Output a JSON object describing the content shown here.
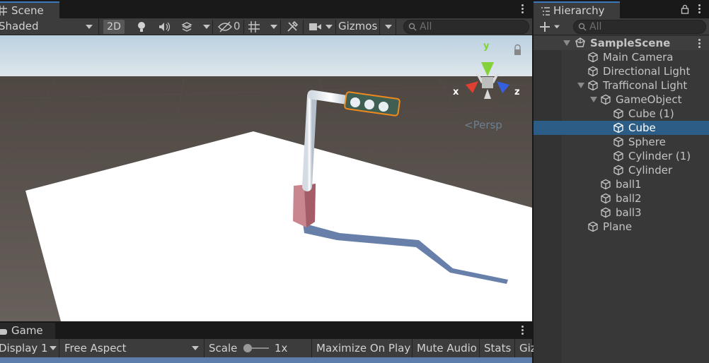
{
  "scene": {
    "tab_label": "Scene",
    "shading_mode": "Shaded",
    "btn_2d": "2D",
    "hidden_count": "0",
    "gizmos_label": "Gizmos",
    "search_placeholder": "All",
    "persp_label": "Persp",
    "axis_x": "x",
    "axis_y": "y",
    "axis_z": "z"
  },
  "game": {
    "tab_label": "Game",
    "display": "Display 1",
    "aspect": "Free Aspect",
    "scale_label": "Scale",
    "scale_value": "1x",
    "maximize": "Maximize On Play",
    "mute": "Mute Audio",
    "stats": "Stats",
    "gizmos_partial": "Giz"
  },
  "hierarchy": {
    "tab_label": "Hierarchy",
    "search_placeholder": "All",
    "scene_name": "SampleScene",
    "items": [
      {
        "label": "Main Camera"
      },
      {
        "label": "Directional Light"
      },
      {
        "label": "Trafficonal Light"
      },
      {
        "label": "GameObject"
      },
      {
        "label": "Cube (1)"
      },
      {
        "label": "Cube"
      },
      {
        "label": "Sphere"
      },
      {
        "label": "Cylinder (1)"
      },
      {
        "label": "Cylinder"
      },
      {
        "label": "ball1"
      },
      {
        "label": "ball2"
      },
      {
        "label": "ball3"
      },
      {
        "label": "Plane"
      }
    ],
    "selected_item": "Cube"
  },
  "colors": {
    "accent_tab": "#3a79bb",
    "selection": "#2c5d87",
    "panel": "#383838",
    "toolbar": "#3c3c3c"
  }
}
